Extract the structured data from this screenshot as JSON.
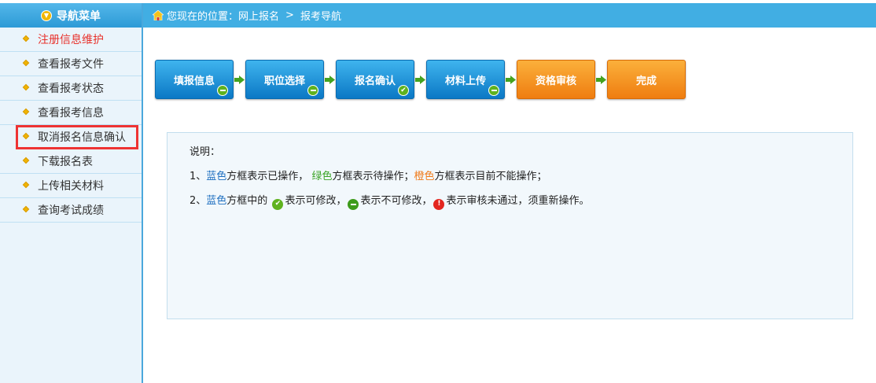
{
  "sidebar": {
    "title": "导航菜单",
    "items": [
      {
        "label": "注册信息维护"
      },
      {
        "label": "查看报考文件"
      },
      {
        "label": "查看报考状态"
      },
      {
        "label": "查看报考信息"
      },
      {
        "label": "取消报名信息确认"
      },
      {
        "label": "下载报名表"
      },
      {
        "label": "上传相关材料"
      },
      {
        "label": "查询考试成绩"
      }
    ]
  },
  "breadcrumb": {
    "prefix": "您现在的位置：",
    "parent": "网上报名",
    "separator": ">",
    "current": "报考导航"
  },
  "steps": [
    {
      "label": "填报信息",
      "color": "blue",
      "badge": "minus"
    },
    {
      "label": "职位选择",
      "color": "blue",
      "badge": "minus"
    },
    {
      "label": "报名确认",
      "color": "blue",
      "badge": "check"
    },
    {
      "label": "材料上传",
      "color": "blue",
      "badge": "minus"
    },
    {
      "label": "资格审核",
      "color": "orange",
      "badge": ""
    },
    {
      "label": "完成",
      "color": "orange",
      "badge": ""
    }
  ],
  "info": {
    "title": "说明：",
    "line1": {
      "num": "1、",
      "blue": "蓝色",
      "t1": "方框表示已操作，",
      "green": "绿色",
      "t2": "方框表示待操作；",
      "orange": "橙色",
      "t3": "方框表示目前不能操作；"
    },
    "line2": {
      "num": "2、",
      "blue": "蓝色",
      "t1": "方框中的",
      "t2": "表示可修改，",
      "t3": "表示不可修改，",
      "t4": "表示审核未通过，须重新操作。"
    }
  },
  "colors": {
    "header_blue": "#41aee3",
    "step_blue": "#0b78c5",
    "step_orange": "#ef7d10",
    "active_red": "#e8322c",
    "highlight_red": "#ee3333"
  }
}
